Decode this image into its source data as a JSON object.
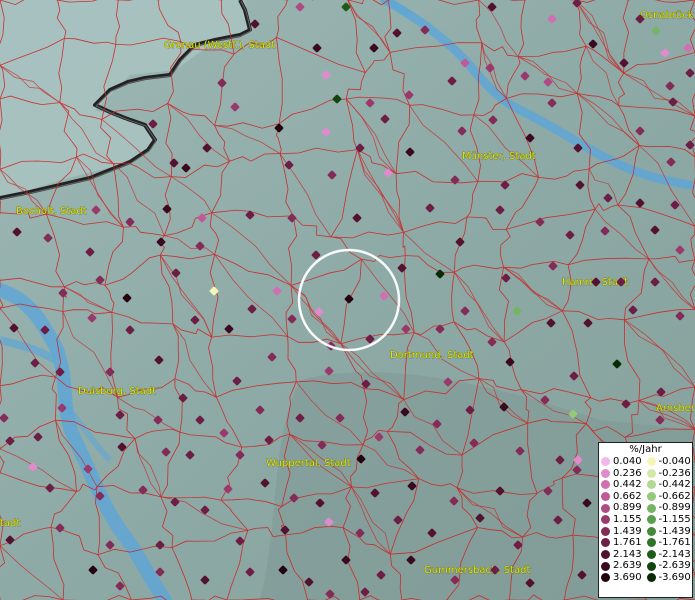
{
  "map": {
    "places": [
      {
        "name": "Gronau (Westf.), Stadt"
      },
      {
        "name": "Münster, Stadt"
      },
      {
        "name": "Osnabrück"
      },
      {
        "name": "Bocholt, Stadt"
      },
      {
        "name": "Hamm, Stadt"
      },
      {
        "name": "Dortmund, Stadt"
      },
      {
        "name": "Duisburg, Stadt"
      },
      {
        "name": "Wuppertal, Stadt"
      },
      {
        "name": "Arnsberg"
      },
      {
        "name": "Gummersbach, Stadt"
      },
      {
        "name": "tadt"
      }
    ]
  },
  "legend": {
    "title": "%/Jahr",
    "positive": [
      {
        "value": "0.040",
        "color": "#f4b8e8"
      },
      {
        "value": "0.236",
        "color": "#e08ccc"
      },
      {
        "value": "0.442",
        "color": "#d070b0"
      },
      {
        "value": "0.662",
        "color": "#c25a98"
      },
      {
        "value": "0.899",
        "color": "#b04a84"
      },
      {
        "value": "1.155",
        "color": "#9a3a6c"
      },
      {
        "value": "1.439",
        "color": "#842c58"
      },
      {
        "value": "1.761",
        "color": "#6c1e44"
      },
      {
        "value": "2.143",
        "color": "#521230"
      },
      {
        "value": "2.639",
        "color": "#3a0a20"
      },
      {
        "value": "3.690",
        "color": "#220410"
      }
    ],
    "negative": [
      {
        "value": "-0.040",
        "color": "#f4f6b8"
      },
      {
        "value": "-0.236",
        "color": "#d4e8a8"
      },
      {
        "value": "-0.442",
        "color": "#b4d894"
      },
      {
        "value": "-0.662",
        "color": "#94c87c"
      },
      {
        "value": "-0.899",
        "color": "#74b464"
      },
      {
        "value": "-1.155",
        "color": "#5aa04c"
      },
      {
        "value": "-1.439",
        "color": "#428a38"
      },
      {
        "value": "-1.761",
        "color": "#2e7428"
      },
      {
        "value": "-2.143",
        "color": "#1e5c1a"
      },
      {
        "value": "-2.639",
        "color": "#12440e"
      },
      {
        "value": "-3.690",
        "color": "#082a06"
      }
    ]
  }
}
